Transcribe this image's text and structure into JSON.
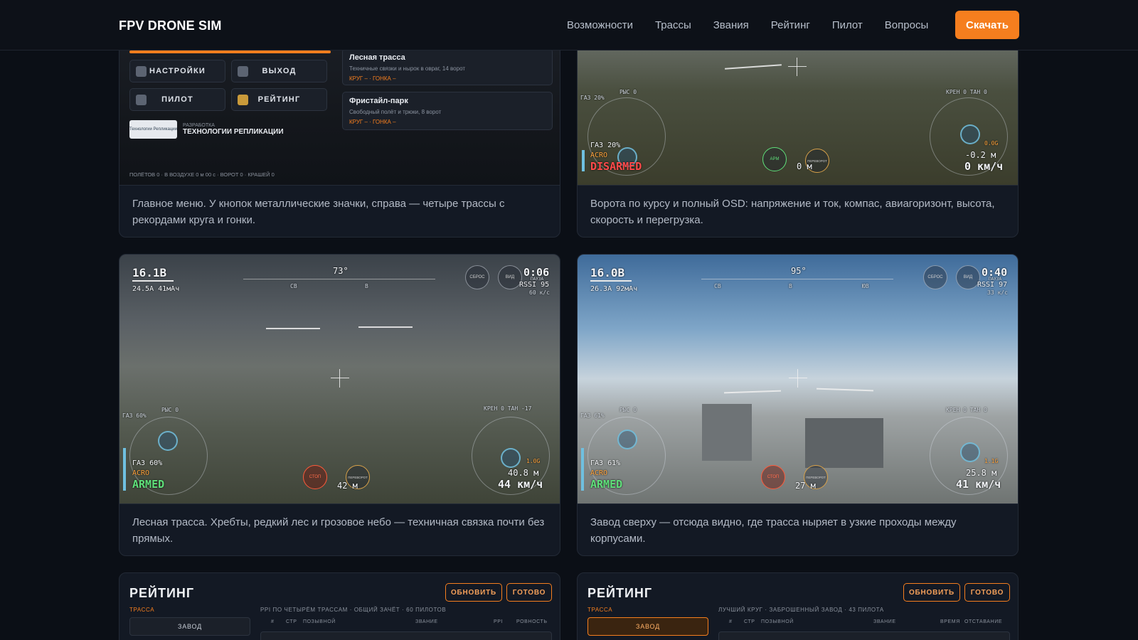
{
  "header": {
    "brand": "FPV DRONE SIM",
    "nav": [
      "Возможности",
      "Трассы",
      "Звания",
      "Рейтинг",
      "Пилот",
      "Вопросы"
    ],
    "download_label": "Скачать"
  },
  "cards": [
    {
      "caption": "Главное меню. У кнопок металлические значки, справа — четыре трассы с рекордами круга и гонки.",
      "menu": {
        "buttons": [
          "НАСТРОЙКИ",
          "ВЫХОД",
          "ПИЛОТ",
          "РЕЙТИНГ"
        ],
        "tracks": [
          {
            "title": "Лесная трасса",
            "desc": "Техничные связки и нырок в овраг, 14 ворот",
            "records": "КРУГ –  ·  ГОНКА –"
          },
          {
            "title": "Фристайл-парк",
            "desc": "Свободный полёт и трюки, 8 ворот",
            "records": "КРУГ –  ·  ГОНКА –"
          }
        ],
        "dev_label": "РАЗРАБОТКА",
        "dev_name": "ТЕХНОЛОГИИ РЕПЛИКАЦИИ",
        "dev_logo": "Технологии Репликации",
        "stats": "ПОЛЁТОВ 0  ·  В ВОЗДУХЕ 0 м 00 с  ·  ВОРОТ 0  ·  КРАШЕЙ 0"
      }
    },
    {
      "caption": "Ворота по курсу и полный OSD: напряжение и ток, компас, авиагоризонт, высота, скорость и перегрузка.",
      "osd": {
        "throttle_small": "ГАЗ 20%",
        "pitch": "РЫС 0",
        "roll_yaw": "КРЕН 0   ТАН 0",
        "throttle": "ГАЗ 20%",
        "mode": "ACRO",
        "state": "DISARMED",
        "gforce": "0.0G",
        "altitude": "-0.2 м",
        "speed": "0 км/ч",
        "distance": "0 м",
        "arm_btn": "АРМ",
        "flip_btn": "ПЕРЕВОРОТ"
      }
    },
    {
      "caption": "Лесная трасса. Хребты, редкий лес и грозовое небо — техничная связка почти без прямых.",
      "osd": {
        "voltage": "16.1В",
        "current": "24.5А  41мАч",
        "heading": "73°",
        "compass_labels": [
          "СВ",
          "В"
        ],
        "timer": "0:06",
        "rssi": "RSSI 95",
        "rate": "60 к/с",
        "reset_btn": "СБРОС",
        "view_btn": "ВИД",
        "pause_label": "ПАУЗА",
        "throttle_small": "ГАЗ 60%",
        "pitch": "РЫС 0",
        "roll_yaw": "КРЕН 0   ТАН -17",
        "throttle": "ГАЗ 60%",
        "mode": "ACRO",
        "state": "ARMED",
        "gforce": "1.0G",
        "altitude": "40.8 м",
        "speed": "44 км/ч",
        "distance": "42 м",
        "stop_btn": "СТОП",
        "flip_btn": "ПЕРЕВОРОТ"
      }
    },
    {
      "caption": "Завод сверху — отсюда видно, где трасса ныряет в узкие проходы между корпусами.",
      "osd": {
        "voltage": "16.0В",
        "current": "26.3А  92мАч",
        "heading": "95°",
        "compass_labels": [
          "СВ",
          "В",
          "ЮВ"
        ],
        "timer": "0:40",
        "rssi": "RSSI 97",
        "rate": "33 к/с",
        "reset_btn": "СБРОС",
        "view_btn": "ВИД",
        "pause_label": "ПАУЗА",
        "throttle_small": "ГАЗ 61%",
        "pitch": "РЫС 0",
        "roll_yaw": "КРЕН 0   ТАН 0",
        "throttle": "ГАЗ 61%",
        "mode": "ACRO",
        "state": "ARMED",
        "gforce": "1.1G",
        "altitude": "25.8 м",
        "speed": "41 км/ч",
        "distance": "27 м",
        "stop_btn": "СТОП",
        "flip_btn": "ПЕРЕВОРОТ"
      }
    }
  ],
  "ratings": [
    {
      "title": "РЕЙТИНГ",
      "refresh": "ОБНОВИТЬ",
      "done": "ГОТОВО",
      "track_label": "ТРАССА",
      "track_value": "ЗАВОД",
      "summary": "PPI ПО ЧЕТЫРЁМ ТРАССАМ  ·  ОБЩИЙ ЗАЧЁТ  ·  60 ПИЛОТОВ",
      "columns": [
        "#",
        "СТР",
        "ПОЗЫВНОЙ",
        "ЗВАНИЕ",
        "PPI",
        "РОВНОСТЬ"
      ]
    },
    {
      "title": "РЕЙТИНГ",
      "refresh": "ОБНОВИТЬ",
      "done": "ГОТОВО",
      "track_label": "ТРАССА",
      "track_value": "ЗАВОД",
      "summary": "ЛУЧШИЙ КРУГ  ·  ЗАБРОШЕННЫЙ ЗАВОД  ·  43 ПИЛОТА",
      "columns": [
        "#",
        "СТР",
        "ПОЗЫВНОЙ",
        "ЗВАНИЕ",
        "ВРЕМЯ",
        "ОТСТАВАНИЕ"
      ]
    }
  ]
}
